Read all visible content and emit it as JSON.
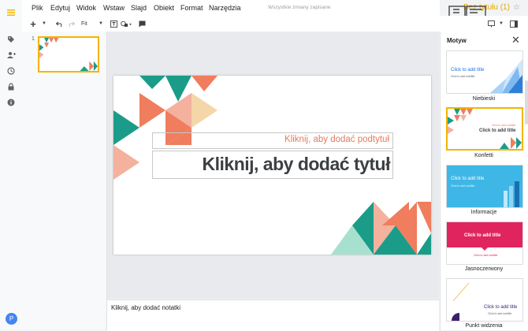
{
  "menu": [
    "Plik",
    "Edytuj",
    "Widok",
    "Wstaw",
    "Slajd",
    "Obiekt",
    "Format",
    "Narzędzia"
  ],
  "saved_status": "Wszystkie zmiany zapisane",
  "document_title": "Bez tytułu (1)",
  "toolbar": {
    "zoom": "Fit"
  },
  "filmstrip": {
    "slide_number": "1"
  },
  "slide": {
    "subtitle_placeholder": "Kliknij, aby dodać podtytuł",
    "title_placeholder": "Kliknij, aby dodać tytuł"
  },
  "notes_placeholder": "Kliknij, aby dodać notatki",
  "theme_panel": {
    "title": "Motyw",
    "themes": [
      {
        "name": "Niebieski",
        "preview_title": "Click to add title",
        "preview_sub": "Click to add subtitle"
      },
      {
        "name": "Konfetti",
        "preview_title": "Click to add title",
        "preview_sub": "Click to add subtitle"
      },
      {
        "name": "Informacje",
        "preview_title": "Click to add title",
        "preview_sub": "Click to add subtitle"
      },
      {
        "name": "Jasnoczerwony",
        "preview_title": "Click to add title",
        "preview_sub": "Click to add subtitle"
      },
      {
        "name": "Punkt widzenia",
        "preview_title": "Click to add title",
        "preview_sub": "Click to add subtitle"
      }
    ]
  },
  "user": {
    "avatar_initial": "P"
  },
  "colors": {
    "accent_yellow": "#f4b400",
    "teal": "#1a9c88",
    "coral": "#ef7d5e",
    "peach": "#f3b19e",
    "sand": "#f5d6a8",
    "blue_theme": "#3eb7e6",
    "pink_theme": "#e0245e"
  }
}
